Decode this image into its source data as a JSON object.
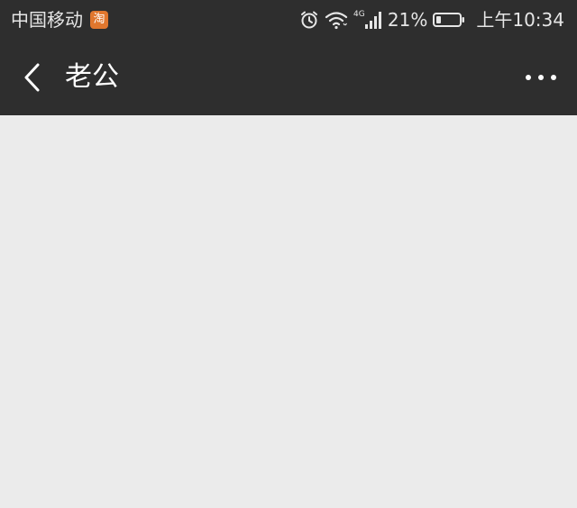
{
  "status_bar": {
    "carrier": "中国移动",
    "app_badge": "淘",
    "network_label": "4G",
    "battery_percent": "21%",
    "time": "上午10:34",
    "battery_level": 0.21,
    "icons": [
      "alarm-icon",
      "wifi-icon",
      "signal-icon",
      "battery-icon"
    ]
  },
  "navbar": {
    "title": "老公",
    "back_icon": "back-arrow-icon",
    "more_icon": "more-options-icon"
  },
  "colors": {
    "bar_background": "#2e2e2e",
    "content_background": "#ebebeb",
    "text_primary": "#ffffff",
    "status_text": "#e6e6e6",
    "badge": "#e0772e"
  }
}
